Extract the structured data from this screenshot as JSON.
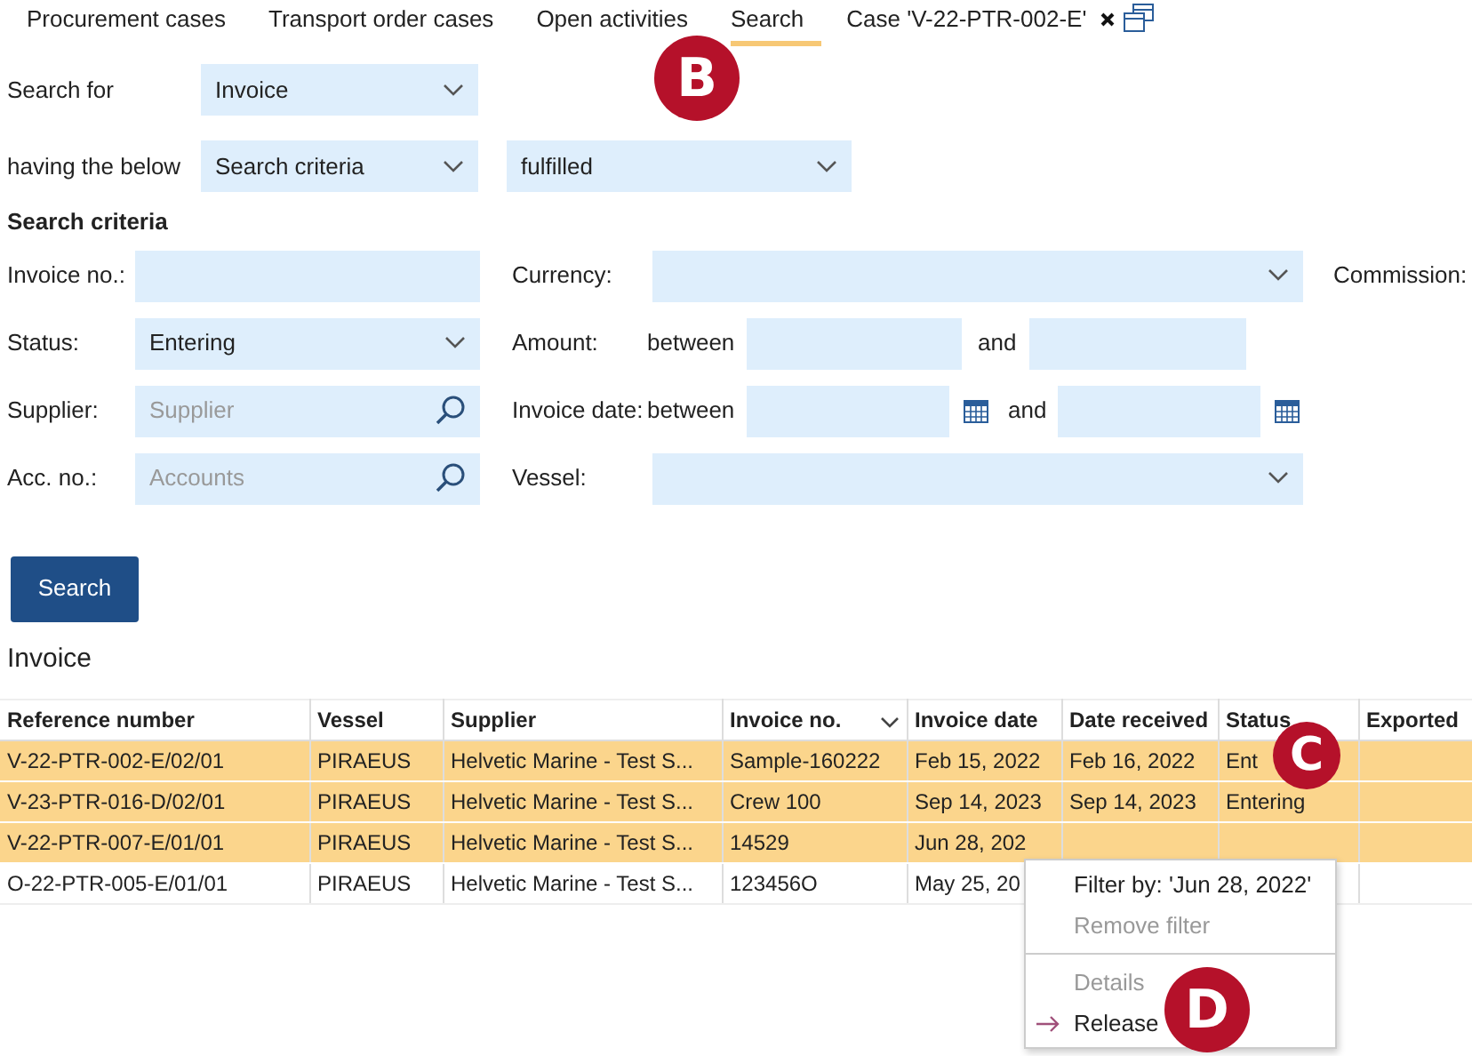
{
  "tabs": [
    {
      "label": "Procurement cases",
      "selected": false,
      "kind": "tab"
    },
    {
      "label": "Transport order cases",
      "selected": false,
      "kind": "tab"
    },
    {
      "label": "Open activities",
      "selected": false,
      "kind": "tab"
    },
    {
      "label": "Search",
      "selected": true,
      "kind": "tab"
    },
    {
      "label": "Case 'V-22-PTR-002-E'",
      "selected": false,
      "kind": "case"
    }
  ],
  "search_for": {
    "label": "Search for",
    "value": "Invoice"
  },
  "having": {
    "label": "having the below",
    "value": "Search criteria",
    "condition": "fulfilled"
  },
  "criteria": {
    "title": "Search criteria",
    "invoice_no": {
      "label": "Invoice no.:"
    },
    "currency": {
      "label": "Currency:"
    },
    "commission": {
      "label": "Commission:"
    },
    "status": {
      "label": "Status:",
      "value": "Entering"
    },
    "amount": {
      "label": "Amount:",
      "between": "between",
      "and": "and"
    },
    "supplier": {
      "label": "Supplier:",
      "placeholder": "Supplier"
    },
    "invoice_date": {
      "label": "Invoice date:",
      "between": "between",
      "and": "and"
    },
    "acc_no": {
      "label": "Acc. no.:",
      "placeholder": "Accounts"
    },
    "vessel": {
      "label": "Vessel:"
    }
  },
  "search_button": "Search",
  "results": {
    "title": "Invoice",
    "columns": [
      {
        "label": "Reference number",
        "sorted": false
      },
      {
        "label": "Vessel",
        "sorted": false
      },
      {
        "label": "Supplier",
        "sorted": false
      },
      {
        "label": "Invoice no.",
        "sorted": true
      },
      {
        "label": "Invoice date",
        "sorted": false
      },
      {
        "label": "Date received",
        "sorted": false
      },
      {
        "label": "Status",
        "sorted": false
      },
      {
        "label": "Exported",
        "sorted": false
      }
    ],
    "rows": [
      {
        "selected": true,
        "cells": [
          "V-22-PTR-002-E/02/01",
          "PIRAEUS",
          "Helvetic Marine - Test S...",
          "Sample-160222",
          "Feb 15, 2022",
          "Feb 16, 2022",
          "Ent",
          null
        ]
      },
      {
        "selected": true,
        "cells": [
          "V-23-PTR-016-D/02/01",
          "PIRAEUS",
          "Helvetic Marine - Test S...",
          "Crew 100",
          "Sep 14, 2023",
          "Sep 14, 2023",
          "Entering",
          null
        ]
      },
      {
        "selected": true,
        "cells": [
          "V-22-PTR-007-E/01/01",
          "PIRAEUS",
          "Helvetic Marine - Test S...",
          "14529",
          "Jun 28, 202",
          null,
          null,
          null
        ]
      },
      {
        "selected": false,
        "cells": [
          "O-22-PTR-005-E/01/01",
          "PIRAEUS",
          "Helvetic Marine - Test S...",
          "123456O",
          "May 25, 20",
          null,
          null,
          null
        ]
      }
    ]
  },
  "context_menu": {
    "sections": [
      [
        {
          "label": "Filter by: 'Jun 28, 2022'",
          "disabled": false,
          "kind": "plain"
        },
        {
          "label": "Remove filter",
          "disabled": true,
          "kind": "plain"
        }
      ],
      [
        {
          "label": "Details",
          "disabled": true,
          "kind": "plain"
        },
        {
          "label": "Release",
          "disabled": false,
          "kind": "arrow"
        }
      ]
    ]
  },
  "callouts": [
    {
      "letter": "B"
    },
    {
      "letter": "C"
    },
    {
      "letter": "D"
    }
  ]
}
